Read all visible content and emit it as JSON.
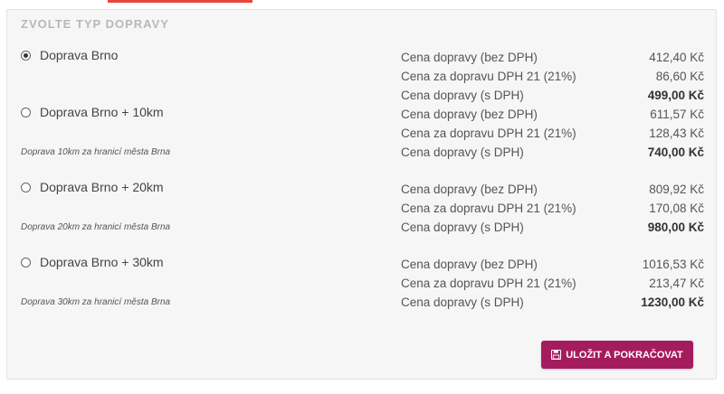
{
  "section": {
    "title": "ZVOLTE TYP DOPRAVY"
  },
  "options": [
    {
      "label": "Doprava Brno",
      "selected": true,
      "note": "",
      "rows": [
        {
          "label": "Cena dopravy (bez DPH)",
          "value": "412,40 Kč"
        },
        {
          "label": "Cena za dopravu DPH 21 (21%)",
          "value": "86,60 Kč"
        },
        {
          "label": "Cena dopravy (s DPH)",
          "value": "499,00 Kč"
        }
      ]
    },
    {
      "label": "Doprava Brno + 10km",
      "selected": false,
      "note": "Doprava 10km za hranicí města Brna",
      "rows": [
        {
          "label": "Cena dopravy (bez DPH)",
          "value": "611,57 Kč"
        },
        {
          "label": "Cena za dopravu DPH 21 (21%)",
          "value": "128,43 Kč"
        },
        {
          "label": "Cena dopravy (s DPH)",
          "value": "740,00 Kč"
        }
      ]
    },
    {
      "label": "Doprava Brno + 20km",
      "selected": false,
      "note": "Doprava 20km za hranicí města Brna",
      "rows": [
        {
          "label": "Cena dopravy (bez DPH)",
          "value": "809,92 Kč"
        },
        {
          "label": "Cena za dopravu DPH 21 (21%)",
          "value": "170,08 Kč"
        },
        {
          "label": "Cena dopravy (s DPH)",
          "value": "980,00 Kč"
        }
      ]
    },
    {
      "label": "Doprava Brno + 30km",
      "selected": false,
      "note": "Doprava 30km za hranicí města Brna",
      "rows": [
        {
          "label": "Cena dopravy (bez DPH)",
          "value": "1016,53 Kč"
        },
        {
          "label": "Cena za dopravu DPH 21 (21%)",
          "value": "213,47 Kč"
        },
        {
          "label": "Cena dopravy (s DPH)",
          "value": "1230,00 Kč"
        }
      ]
    }
  ],
  "actions": {
    "save_label": "ULOŽIT A POKRAČOVAT",
    "save_icon": "floppy-disk-icon"
  },
  "colors": {
    "accent": "#e8463c",
    "button": "#a51c5e"
  }
}
